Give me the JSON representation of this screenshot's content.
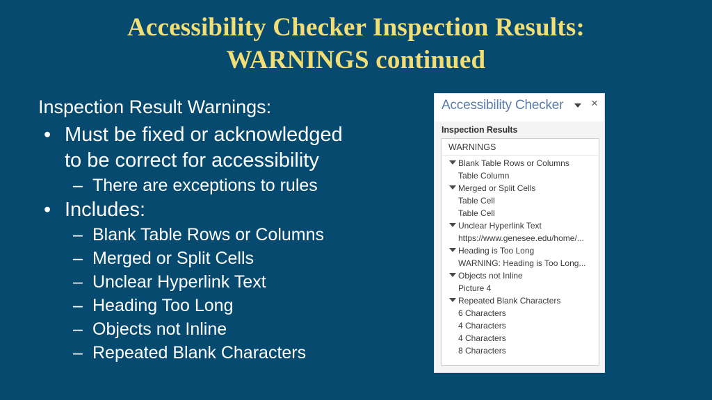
{
  "slide": {
    "background_color": "#064A70",
    "title_color": "#F2DE74",
    "title_line1": "Accessibility Checker Inspection Results:",
    "title_line2": "WARNINGS continued"
  },
  "body": {
    "lead": "Inspection Result Warnings:",
    "bullets": [
      {
        "bullet_glyph": "•",
        "text": "Must be fixed or acknowledged",
        "continuation": "to be correct for accessibility",
        "subs": [
          {
            "dash": "–",
            "text": "There are exceptions to rules"
          }
        ]
      },
      {
        "bullet_glyph": "•",
        "text": "Includes:",
        "continuation": "",
        "subs": [
          {
            "dash": "–",
            "text": "Blank Table Rows or Columns"
          },
          {
            "dash": "–",
            "text": "Merged or Split Cells"
          },
          {
            "dash": "–",
            "text": "Unclear Hyperlink Text"
          },
          {
            "dash": "–",
            "text": "Heading Too Long"
          },
          {
            "dash": "–",
            "text": "Objects not Inline"
          },
          {
            "dash": "–",
            "text": "Repeated Blank Characters"
          }
        ]
      }
    ]
  },
  "panel": {
    "title": "Accessibility Checker",
    "title_color": "#5B7BA8",
    "caret_icon": "chevron-down-icon",
    "close_icon": "×",
    "subheading": "Inspection Results",
    "list_header": "WARNINGS",
    "groups": [
      {
        "marker_icon": "expand-triangle-icon",
        "label": "Blank Table Rows or Columns",
        "children": [
          "Table Column"
        ]
      },
      {
        "marker_icon": "expand-triangle-icon",
        "label": "Merged or Split Cells",
        "children": [
          "Table Cell",
          "Table Cell"
        ]
      },
      {
        "marker_icon": "expand-triangle-icon",
        "label": "Unclear Hyperlink Text",
        "children": [
          "https://www.genesee.edu/home/..."
        ]
      },
      {
        "marker_icon": "expand-triangle-icon",
        "label": "Heading is Too Long",
        "children": [
          "WARNING: Heading is Too Long..."
        ]
      },
      {
        "marker_icon": "expand-triangle-icon",
        "label": "Objects not Inline",
        "children": [
          "Picture 4"
        ]
      },
      {
        "marker_icon": "expand-triangle-icon",
        "label": "Repeated Blank Characters",
        "children": [
          "6 Characters",
          "4 Characters",
          "4 Characters",
          "8 Characters"
        ]
      }
    ]
  }
}
